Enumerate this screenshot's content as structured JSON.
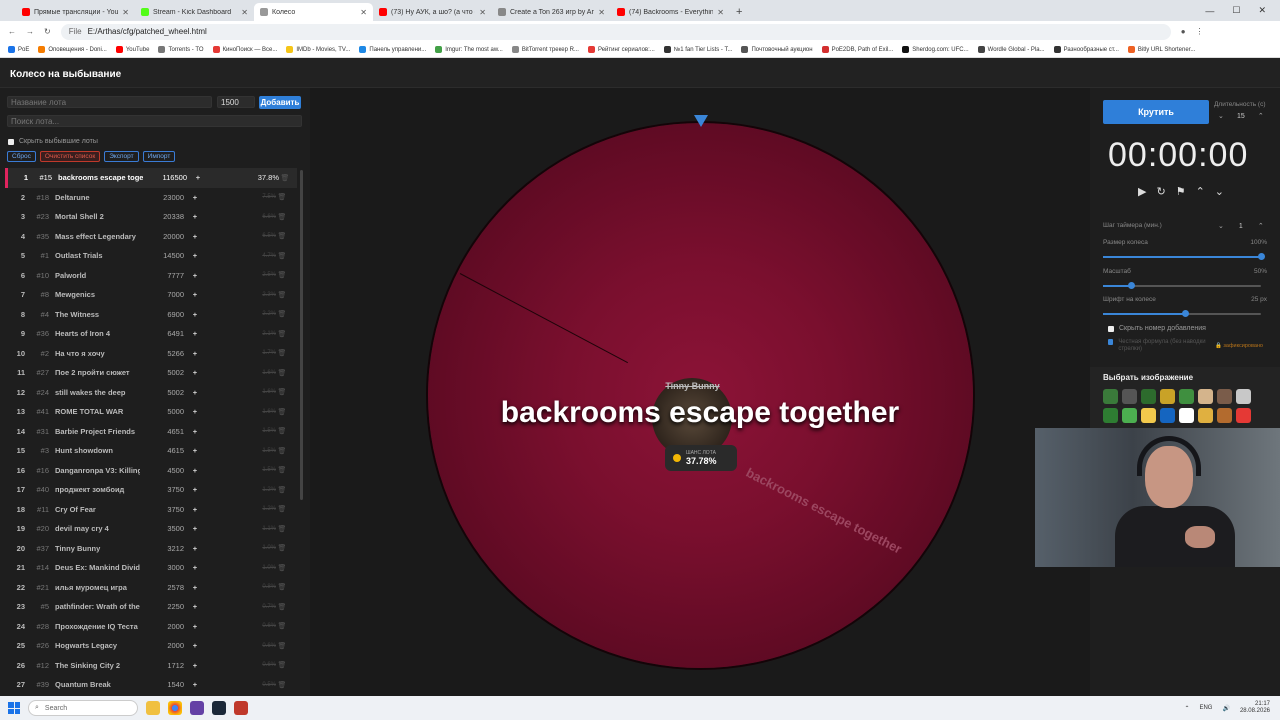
{
  "browser": {
    "tabs": [
      {
        "title": "Прямые трансляции - YouTube",
        "color": "#ff0000"
      },
      {
        "title": "Stream - Kick Dashboard",
        "color": "#53fc18"
      },
      {
        "title": "Колесо",
        "color": "#999999",
        "active": true
      },
      {
        "title": "(73) Ну АУК, а шо? (а что стри",
        "color": "#ff0000"
      },
      {
        "title": "Create a Ton 263 игр by Artho",
        "color": "#888888"
      },
      {
        "title": "(74) Backrooms - Everything M",
        "color": "#ff0000"
      }
    ],
    "new_tab": "+",
    "url_scheme": "File",
    "url": "E:/Arthas/cfg/patched_wheel.html",
    "bookmarks": [
      "PoE",
      "Оповещения - Doni...",
      "YouTube",
      "Torrents - TO",
      "КиноПоиск — Все...",
      "IMDb - Movies, TV...",
      "Панель управлени...",
      "Imgur: The most aw...",
      "BitTorrent трекер R...",
      "Рейтинг сериалов:...",
      "№1 fan Tier Lists - T...",
      "Почтовочный аукцион",
      "PoE2DB, Path of Exil...",
      "Sherdog.com: UFC...",
      "Wordle Global - Pla...",
      "Разнообразные ст...",
      "Bitly URL Shortener..."
    ]
  },
  "app": {
    "title": "Колесо на выбывание",
    "lot_name_placeholder": "Название лота",
    "lot_amount": "1500",
    "add_label": "Добавить",
    "search_placeholder": "Поиск лота...",
    "hide_eliminated": "Скрыть выбывшие лоты",
    "btn_reset": "Сброс",
    "btn_clear": "Очистить список",
    "btn_export": "Экспорт",
    "btn_import": "Импорт",
    "lots": [
      {
        "n": "1",
        "id": "#15",
        "name": "backrooms escape together",
        "amount": "116500",
        "pct": "37.8%"
      },
      {
        "n": "2",
        "id": "#18",
        "name": "Deltarune",
        "amount": "23000",
        "pct": "7.5%"
      },
      {
        "n": "3",
        "id": "#23",
        "name": "Mortal Shell 2",
        "amount": "20338",
        "pct": "6.6%"
      },
      {
        "n": "4",
        "id": "#35",
        "name": "Mass effect Legendary",
        "amount": "20000",
        "pct": "6.5%"
      },
      {
        "n": "5",
        "id": "#1",
        "name": "Outlast Trials",
        "amount": "14500",
        "pct": "4.7%"
      },
      {
        "n": "6",
        "id": "#10",
        "name": "Palworld",
        "amount": "7777",
        "pct": "2.5%"
      },
      {
        "n": "7",
        "id": "#8",
        "name": "Mewgenics",
        "amount": "7000",
        "pct": "2.3%"
      },
      {
        "n": "8",
        "id": "#4",
        "name": "The Witness",
        "amount": "6900",
        "pct": "2.2%"
      },
      {
        "n": "9",
        "id": "#36",
        "name": "Hearts of Iron 4",
        "amount": "6491",
        "pct": "2.1%"
      },
      {
        "n": "10",
        "id": "#2",
        "name": "На что я хочу",
        "amount": "5266",
        "pct": "1.7%"
      },
      {
        "n": "11",
        "id": "#27",
        "name": "Пое 2 пройти сюжет",
        "amount": "5002",
        "pct": "1.6%"
      },
      {
        "n": "12",
        "id": "#24",
        "name": "still wakes the deep",
        "amount": "5002",
        "pct": "1.6%"
      },
      {
        "n": "13",
        "id": "#41",
        "name": "ROME TOTAL WAR",
        "amount": "5000",
        "pct": "1.6%"
      },
      {
        "n": "14",
        "id": "#31",
        "name": "Barbie Project Friends",
        "amount": "4651",
        "pct": "1.5%"
      },
      {
        "n": "15",
        "id": "#3",
        "name": "Hunt showdown",
        "amount": "4615",
        "pct": "1.5%"
      },
      {
        "n": "16",
        "id": "#16",
        "name": "Danganronpa V3: Killing",
        "amount": "4500",
        "pct": "1.5%"
      },
      {
        "n": "17",
        "id": "#40",
        "name": "проджект зомбоид",
        "amount": "3750",
        "pct": "1.2%"
      },
      {
        "n": "18",
        "id": "#11",
        "name": "Cry Of Fear",
        "amount": "3750",
        "pct": "1.2%"
      },
      {
        "n": "19",
        "id": "#20",
        "name": "devil may cry 4",
        "amount": "3500",
        "pct": "1.1%"
      },
      {
        "n": "20",
        "id": "#37",
        "name": "Tinny Bunny",
        "amount": "3212",
        "pct": "1.0%"
      },
      {
        "n": "21",
        "id": "#14",
        "name": "Deus Ex: Mankind Divided",
        "amount": "3000",
        "pct": "1.0%"
      },
      {
        "n": "22",
        "id": "#21",
        "name": "илья муромец игра",
        "amount": "2578",
        "pct": "0.8%"
      },
      {
        "n": "23",
        "id": "#5",
        "name": "pathfinder: Wrath of the",
        "amount": "2250",
        "pct": "0.7%"
      },
      {
        "n": "24",
        "id": "#28",
        "name": "Прохождение IQ Теста",
        "amount": "2000",
        "pct": "0.6%"
      },
      {
        "n": "25",
        "id": "#26",
        "name": "Hogwarts Legacy",
        "amount": "2000",
        "pct": "0.6%"
      },
      {
        "n": "26",
        "id": "#12",
        "name": "The Sinking City 2",
        "amount": "1712",
        "pct": "0.6%"
      },
      {
        "n": "27",
        "id": "#39",
        "name": "Quantum Break",
        "amount": "1540",
        "pct": "0.5%"
      }
    ],
    "wheel": {
      "winner": "backrooms escape together",
      "side_label": "backrooms escape together",
      "hub_name": "Tinny Bunny",
      "chance_label": "ШАНС ЛОТА",
      "chance_value": "37.78%"
    },
    "controls": {
      "spin_label": "Крутить",
      "duration_label": "Длительность (с)",
      "duration_value": "15",
      "timer": "00:00:00",
      "timer_step_label": "Шаг таймера (мин.)",
      "timer_step_value": "1",
      "wheel_size_label": "Размер колеса",
      "wheel_size_value": "100%",
      "wheel_size_fraction": 1.0,
      "scale_label": "Масштаб",
      "scale_value": "50%",
      "scale_fraction": 0.18,
      "font_label": "Шрифт на колесе",
      "font_value": "25 px",
      "font_fraction": 0.52,
      "hide_number_label": "Скрыть номер добавления",
      "fair_formula_label": "Честная формула (без наводки стрелки)",
      "fixed_label": "зафиксировано",
      "image_title": "Выбрать изображение"
    }
  },
  "taskbar": {
    "search_placeholder": "Search",
    "lang": "ENG",
    "time": "21:17",
    "date": "28.08.2026"
  }
}
